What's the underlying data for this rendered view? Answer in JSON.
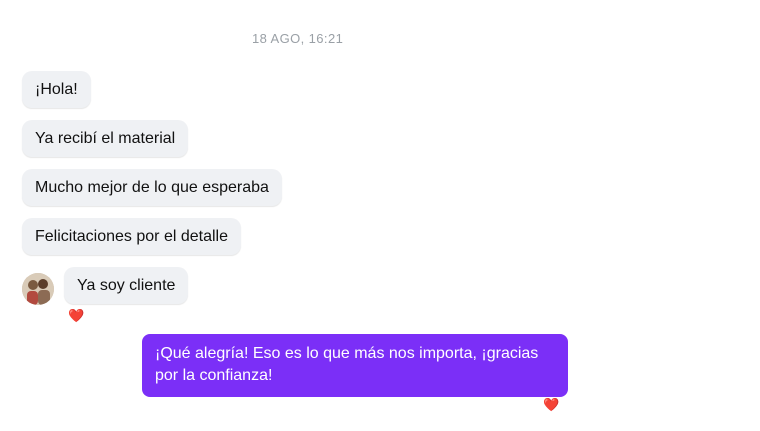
{
  "conversation": {
    "timestamp": "18 AGO, 16:21",
    "incoming": [
      {
        "text": "¡Hola!"
      },
      {
        "text": "Ya recibí el material"
      },
      {
        "text": "Mucho mejor de lo que esperaba"
      },
      {
        "text": "Felicitaciones por el detalle"
      },
      {
        "text": "Ya soy cliente"
      }
    ],
    "incoming_reaction": "❤️",
    "outgoing": {
      "text": "¡Qué alegría! Eso es lo que más nos importa, ¡gracias por la confianza!",
      "reaction": "❤️"
    }
  },
  "colors": {
    "incoming_bubble": "#eff1f4",
    "outgoing_bubble": "#7b2ff7",
    "timestamp": "#9aa0a6"
  }
}
